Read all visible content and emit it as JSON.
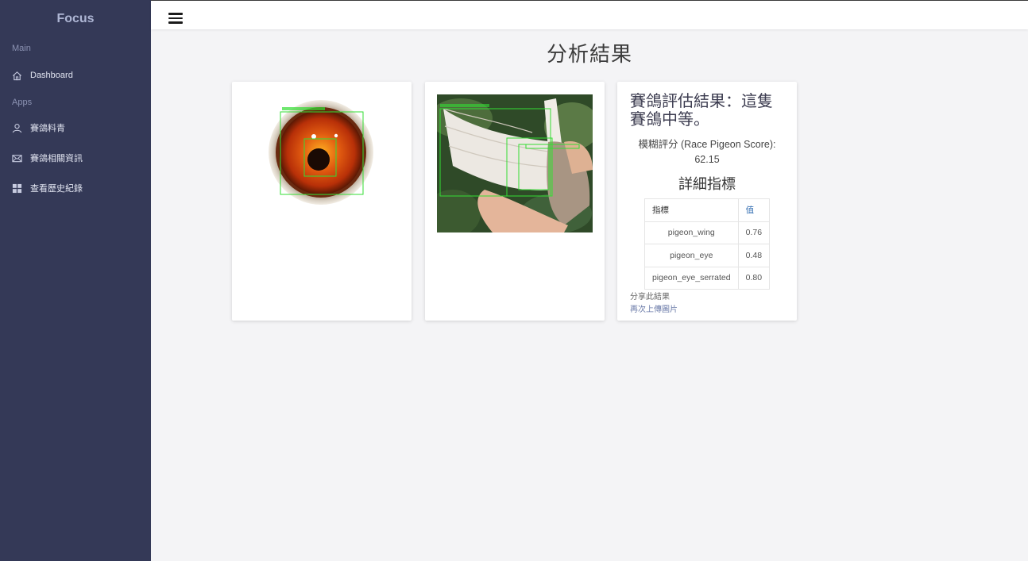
{
  "brand": "Focus",
  "sidebar": {
    "main_label": "Main",
    "apps_label": "Apps",
    "items": [
      {
        "label": "Dashboard",
        "icon": "home-icon"
      },
      {
        "label": "賽鴿料青",
        "icon": "user-icon"
      },
      {
        "label": "賽鴿相關資訊",
        "icon": "mail-icon"
      },
      {
        "label": "查看歷史紀錄",
        "icon": "grid-icon"
      }
    ]
  },
  "page": {
    "title": "分析結果"
  },
  "result": {
    "title": "賽鴿評估結果：這隻賽鴿中等。",
    "score_label": "模糊評分 (Race Pigeon Score):",
    "score_value": "62.15",
    "detail_title": "詳細指標",
    "table": {
      "headers": [
        "指標",
        "值"
      ],
      "rows": [
        {
          "metric": "pigeon_wing",
          "value": "0.76"
        },
        {
          "metric": "pigeon_eye",
          "value": "0.48"
        },
        {
          "metric": "pigeon_eye_serrated",
          "value": "0.80"
        }
      ]
    },
    "share_link": "分享此結果",
    "reupload_link": "再次上傳圖片"
  },
  "colors": {
    "sidebar_bg": "#343957",
    "detection_box": "#33dd33",
    "background": "#f4f4f6"
  }
}
